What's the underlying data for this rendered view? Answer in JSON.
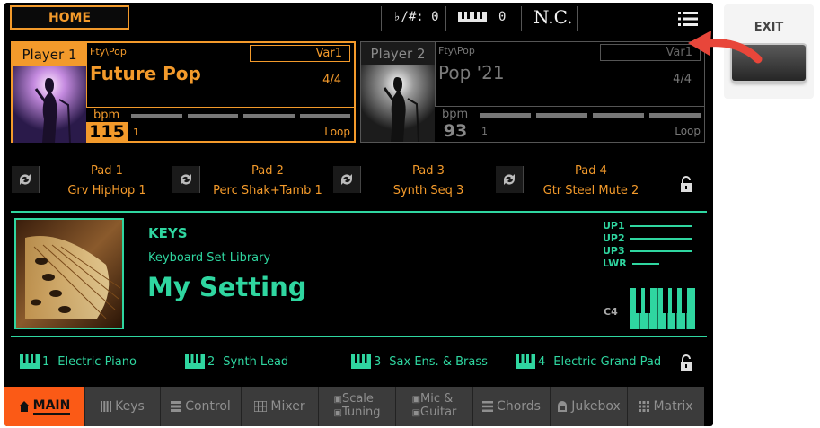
{
  "topbar": {
    "home_label": "HOME",
    "transpose": "♭/#: 0",
    "octave_value": "0",
    "chord": "N.C."
  },
  "players": [
    {
      "label": "Player 1",
      "category": "Fty\\Pop",
      "variation": "Var1",
      "style_name": "Future Pop",
      "meter": "4/4",
      "bpm_label": "bpm",
      "tempo": "115",
      "extra": "1",
      "loop": "Loop"
    },
    {
      "label": "Player 2",
      "category": "Fty\\Pop",
      "variation": "Var1",
      "style_name": "Pop '21",
      "meter": "4/4",
      "bpm_label": "bpm",
      "tempo": "93",
      "extra": "1",
      "loop": "Loop"
    }
  ],
  "pads": [
    {
      "name": "Pad 1",
      "value": "Grv HipHop 1"
    },
    {
      "name": "Pad 2",
      "value": "Perc Shak+Tamb 1"
    },
    {
      "name": "Pad 3",
      "value": "Synth Seq 3"
    },
    {
      "name": "Pad 4",
      "value": "Gtr Steel Mute 2"
    }
  ],
  "keys": {
    "title": "KEYS",
    "library": "Keyboard Set Library",
    "name": "My Setting",
    "parts": [
      "UP1",
      "UP2",
      "UP3",
      "LWR"
    ],
    "octave_label": "C4"
  },
  "sounds": [
    {
      "num": "1",
      "name": "Electric Piano"
    },
    {
      "num": "2",
      "name": "Synth Lead"
    },
    {
      "num": "3",
      "name": "Sax Ens. & Brass"
    },
    {
      "num": "4",
      "name": "Electric Grand Pad"
    }
  ],
  "tabs": [
    {
      "label": "MAIN",
      "icon": "home-icon",
      "active": true
    },
    {
      "label": "Keys",
      "icon": "keyboard-icon"
    },
    {
      "label": "Control",
      "icon": "control-icon"
    },
    {
      "label": "Mixer",
      "icon": "mixer-icon"
    },
    {
      "line1": "Scale",
      "line2": "Tuning",
      "icon": "scale-icon"
    },
    {
      "line1": "Mic &",
      "line2": "Guitar",
      "icon": "mic-icon"
    },
    {
      "label": "Chords",
      "icon": "chords-icon"
    },
    {
      "label": "Jukebox",
      "icon": "jukebox-icon"
    },
    {
      "label": "Matrix",
      "icon": "matrix-icon"
    }
  ],
  "exit": {
    "label": "EXIT"
  },
  "colors": {
    "accent_orange": "#f39a2b",
    "accent_green": "#2fd6a0",
    "tab_active": "#fb5a16",
    "arrow": "#e8463a"
  }
}
